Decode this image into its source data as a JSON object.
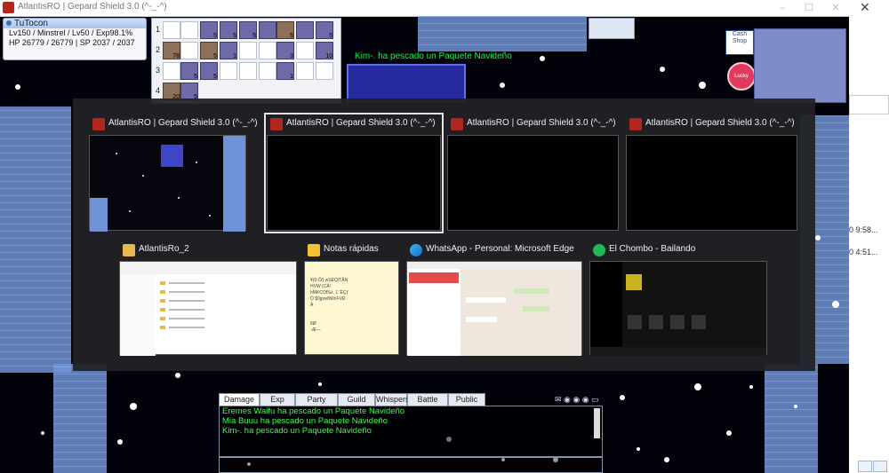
{
  "window": {
    "title": "AtlantisRO | Gepard Shield 3.0 (^-_-^)",
    "controls": [
      "–",
      "☐",
      "✕"
    ]
  },
  "character": {
    "name": "TuTocon",
    "level_line": "Lv150 / Minstrel / Lv50 / Exp98.1%",
    "stats_line": "HP 26779 / 26779 | SP 2037 / 2037"
  },
  "inventory": {
    "rows": [
      {
        "label": "1",
        "counts": [
          "",
          "",
          "5",
          "5",
          "5",
          "",
          "5",
          "",
          "5",
          "10"
        ]
      },
      {
        "label": "2",
        "counts": [
          "78",
          "",
          "5",
          "1",
          "",
          "",
          "3",
          "",
          "10",
          ""
        ]
      },
      {
        "label": "3",
        "counts": [
          "",
          "5",
          "5",
          "",
          "",
          "",
          "1",
          "",
          "",
          ""
        ]
      },
      {
        "label": "4",
        "counts": [
          "20",
          "5",
          "",
          "",
          "",
          "",
          "",
          "",
          "",
          ""
        ]
      }
    ]
  },
  "notice": "Kim-. ha pescado un Paquete Navideño",
  "minimap": {
    "cash_shop": "Cash Shop",
    "lucky": "Lucky"
  },
  "task_switcher": {
    "windows": [
      {
        "title": "AtlantisRO | Gepard Shield 3.0 (^-_-^)",
        "icon": "ro-app-icon",
        "selected": false
      },
      {
        "title": "AtlantisRO | Gepard Shield 3.0 (^-_-^)",
        "icon": "ro-app-icon",
        "selected": true
      },
      {
        "title": "AtlantisRO | Gepard Shield 3.0 (^-_-^)",
        "icon": "ro-app-icon",
        "selected": false
      },
      {
        "title": "AtlantisRO | Gepard Shield 3.0 (^-_-^)",
        "icon": "ro-app-icon",
        "selected": false
      },
      {
        "title": "AtlantisRo_2",
        "icon": "folder-icon",
        "selected": false
      },
      {
        "title": "Notas rápidas",
        "icon": "sticky-notes-icon",
        "selected": false
      },
      {
        "title": "WhatsApp - Personal: Microsoft Edge",
        "icon": "edge-icon",
        "selected": false
      },
      {
        "title": "El Chombo - Bailando",
        "icon": "spotify-icon",
        "selected": false
      }
    ],
    "notes_preview": "¥(0-Ô⁄) wSEQ/TÅN\nHVW (CÄ!\nhMKCOf‰t. 1 'ÈÇƒ\nÒ $9jpre8WnFVÐ\nÀ\n\n\n6Ø\n·Æ—"
  },
  "chat": {
    "tabs": [
      "Damage",
      "Exp",
      "Party",
      "Guild",
      "Whispers",
      "Battle",
      "Public"
    ],
    "active_tab": "Damage",
    "messages": [
      "Eremes Waifu ha pescado un Paquete Navideño",
      "Mia Buuu ha pescado un Paquete Navideño",
      "Kim-. ha pescado un Paquete Navideño"
    ]
  },
  "right_strip": {
    "times": [
      "0 9:58...",
      "0 4:51..."
    ]
  },
  "colors": {
    "switcher_bg": "#222226",
    "chat_text": "#39ff4b",
    "floor_tile": "#7aa0e0"
  }
}
